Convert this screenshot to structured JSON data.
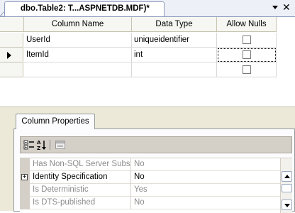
{
  "document_tab": {
    "title": "dbo.Table2: T...ASPNETDB.MDF)*"
  },
  "table_grid": {
    "columns": [
      "Column Name",
      "Data Type",
      "Allow Nulls"
    ],
    "rows": [
      {
        "name": "UserId",
        "type": "uniqueidentifier",
        "allow_nulls": false
      },
      {
        "name": "ItemId",
        "type": "int",
        "allow_nulls": false,
        "current": true
      },
      {
        "name": "",
        "type": "",
        "allow_nulls": false
      }
    ]
  },
  "column_properties": {
    "tab_label": "Column Properties",
    "properties": [
      {
        "name": "Has Non-SQL Server Subs",
        "value": "No",
        "grayed": true,
        "expandable": false
      },
      {
        "name": "Identity Specification",
        "value": "No",
        "grayed": false,
        "expandable": true
      },
      {
        "name": "Is Deterministic",
        "value": "Yes",
        "grayed": true,
        "expandable": false
      },
      {
        "name": "Is DTS-published",
        "value": "No",
        "grayed": true,
        "expandable": false
      }
    ]
  },
  "icons": {
    "categorized": "categorized-icon",
    "alphabetical": "alphabetical-sort-icon",
    "property_pages": "property-pages-icon",
    "dropdown": "chevron-down-icon",
    "close": "close-icon"
  }
}
